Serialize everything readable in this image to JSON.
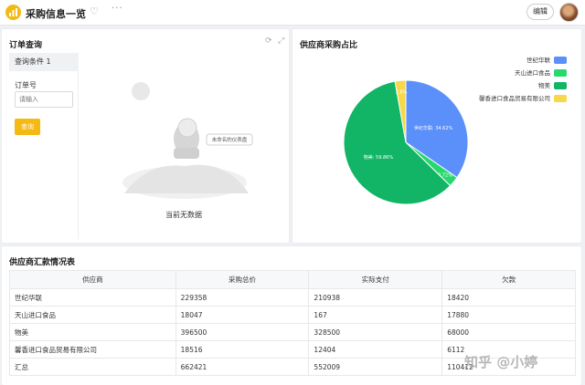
{
  "app": {
    "title": "采购信息一览",
    "edit_label": "编辑",
    "more_label": "···",
    "heart_label": "♡"
  },
  "order_card": {
    "title": "订单查询",
    "tab_label": "查询条件 1",
    "field_label": "订单号",
    "input_placeholder": "请输入",
    "query_button": "查询",
    "empty_text": "当前无数据",
    "tooltip": "未命名的仪表盘"
  },
  "pie_card": {
    "title": "供应商采购占比"
  },
  "chart_data": {
    "type": "pie",
    "title": "供应商采购占比",
    "series": [
      {
        "name": "世纪华联",
        "value": 34.62,
        "color": "#5b8ff9"
      },
      {
        "name": "天山进口食品",
        "value": 2.72,
        "color": "#27d86d"
      },
      {
        "name": "物美",
        "value": 59.86,
        "color": "#12b565"
      },
      {
        "name": "馨香进口食品贸易有限公司",
        "value": 2.8,
        "color": "#f7d84a"
      }
    ],
    "labels": {
      "s0": "世纪华联: 34.62%",
      "s1": "2.72%",
      "s2": "物美: 59.86%",
      "s3": "2.8%"
    },
    "legend_position": "top-right"
  },
  "table": {
    "title": "供应商汇款情况表",
    "headers": [
      "供应商",
      "采购总价",
      "实际支付",
      "欠款"
    ],
    "rows": [
      [
        "世纪华联",
        "229358",
        "210938",
        "18420"
      ],
      [
        "天山进口食品",
        "18047",
        "167",
        "17880"
      ],
      [
        "物美",
        "396500",
        "328500",
        "68000"
      ],
      [
        "馨香进口食品贸易有限公司",
        "18516",
        "12404",
        "6112"
      ],
      [
        "汇总",
        "662421",
        "552009",
        "110412"
      ]
    ]
  },
  "watermark": "知乎 @小婷"
}
